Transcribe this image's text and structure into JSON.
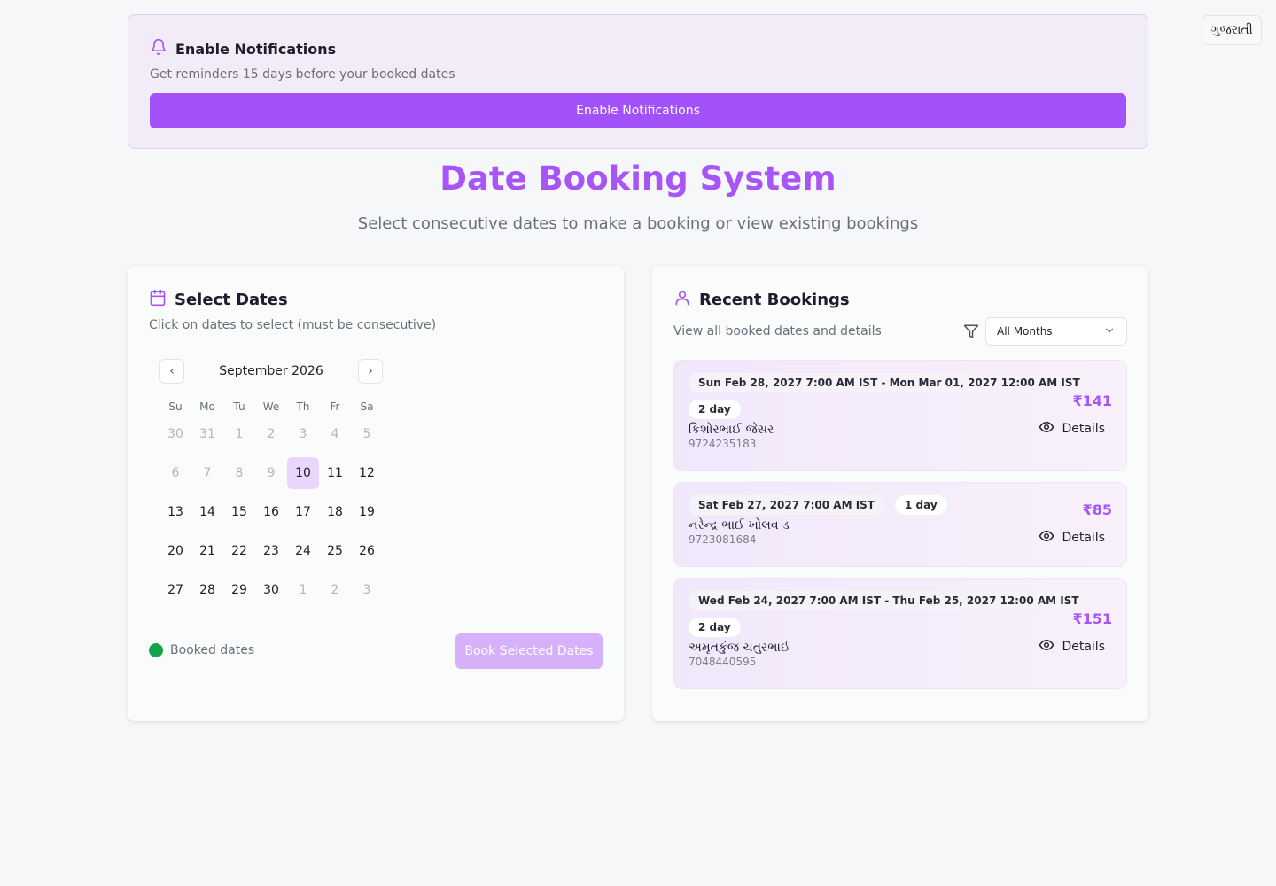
{
  "language_button": "ગુજરાતી",
  "notification": {
    "title": "Enable Notifications",
    "subtitle": "Get reminders 15 days before your booked dates",
    "button": "Enable Notifications"
  },
  "header": {
    "title": "Date Booking System",
    "subtitle": "Select consecutive dates to make a booking or view existing bookings"
  },
  "select_dates": {
    "title": "Select Dates",
    "subtitle": "Click on dates to select (must be consecutive)",
    "calendar": {
      "month": "September 2026",
      "weekdays": [
        "Su",
        "Mo",
        "Tu",
        "We",
        "Th",
        "Fr",
        "Sa"
      ],
      "days": [
        {
          "d": "30",
          "muted": true
        },
        {
          "d": "31",
          "muted": true
        },
        {
          "d": "1",
          "muted": true
        },
        {
          "d": "2",
          "muted": true
        },
        {
          "d": "3",
          "muted": true
        },
        {
          "d": "4",
          "muted": true
        },
        {
          "d": "5",
          "muted": true
        },
        {
          "d": "6",
          "muted": true
        },
        {
          "d": "7",
          "muted": true
        },
        {
          "d": "8",
          "muted": true
        },
        {
          "d": "9",
          "muted": true
        },
        {
          "d": "10",
          "selected": true
        },
        {
          "d": "11"
        },
        {
          "d": "12"
        },
        {
          "d": "13"
        },
        {
          "d": "14"
        },
        {
          "d": "15"
        },
        {
          "d": "16"
        },
        {
          "d": "17"
        },
        {
          "d": "18"
        },
        {
          "d": "19"
        },
        {
          "d": "20"
        },
        {
          "d": "21"
        },
        {
          "d": "22"
        },
        {
          "d": "23"
        },
        {
          "d": "24"
        },
        {
          "d": "25"
        },
        {
          "d": "26"
        },
        {
          "d": "27"
        },
        {
          "d": "28"
        },
        {
          "d": "29"
        },
        {
          "d": "30"
        },
        {
          "d": "1",
          "muted": true
        },
        {
          "d": "2",
          "muted": true
        },
        {
          "d": "3",
          "muted": true
        }
      ]
    },
    "legend": "Booked dates",
    "book_button": "Book Selected Dates"
  },
  "recent_bookings": {
    "title": "Recent Bookings",
    "subtitle": "View all booked dates and details",
    "filter_value": "All Months",
    "items": [
      {
        "dates": "Sun Feb 28, 2027 7:00 AM IST - Mon Mar 01, 2027 12:00 AM IST",
        "duration": "2 day",
        "name": "કિશોરભાઈ જેસર",
        "phone": "9724235183",
        "price": "₹141",
        "details": "Details"
      },
      {
        "dates": "Sat Feb 27, 2027 7:00 AM IST",
        "duration": "1 day",
        "name": "નરેન્દ્ર ભાઈ ખોલવ ડ",
        "phone": "9723081684",
        "price": "₹85",
        "details": "Details"
      },
      {
        "dates": "Wed Feb 24, 2027 7:00 AM IST - Thu Feb 25, 2027 12:00 AM IST",
        "duration": "2 day",
        "name": "અમૃતકુંજ ચતુરભાઈ",
        "phone": "7048440595",
        "price": "₹151",
        "details": "Details"
      }
    ]
  },
  "colors": {
    "accent": "#a855f7",
    "button": "#a251fb",
    "booked_dot": "#16a34a",
    "selected_day": "#ead6fb"
  }
}
